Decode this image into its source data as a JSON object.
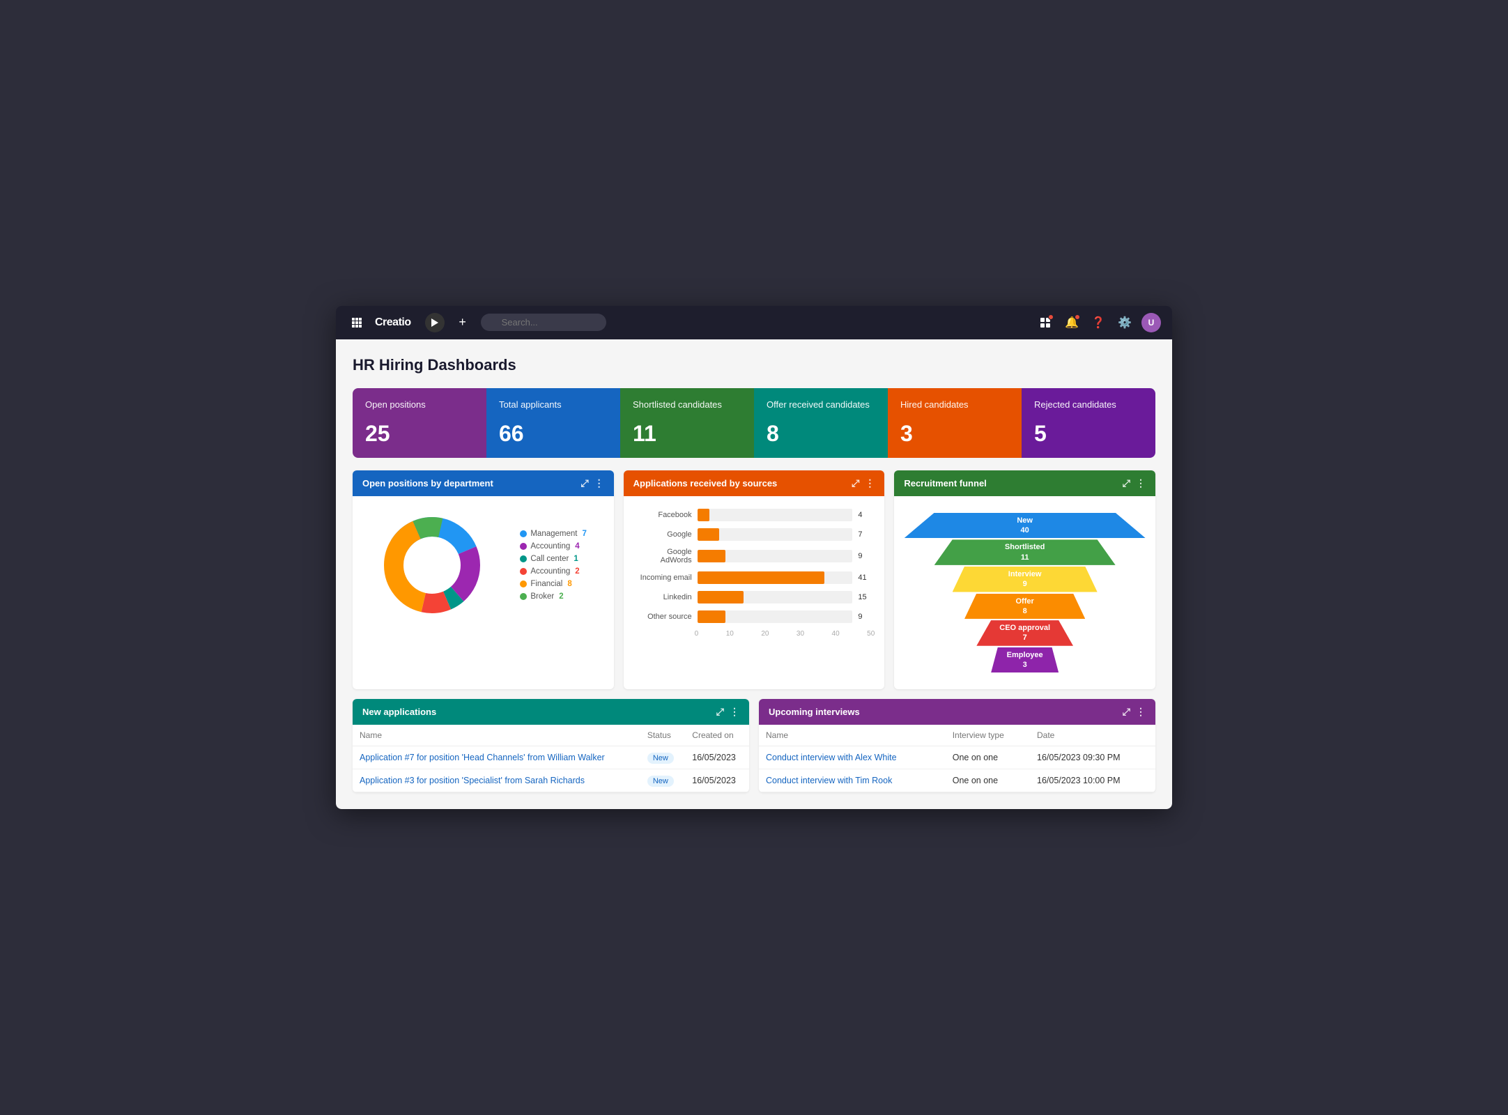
{
  "app": {
    "title": "Creatio",
    "search_placeholder": "Search..."
  },
  "page": {
    "title": "HR Hiring Dashboards"
  },
  "stat_cards": [
    {
      "label": "Open positions",
      "value": "25",
      "color": "stat-purple"
    },
    {
      "label": "Total applicants",
      "value": "66",
      "color": "stat-blue"
    },
    {
      "label": "Shortlisted candidates",
      "value": "11",
      "color": "stat-green"
    },
    {
      "label": "Offer received candidates",
      "value": "8",
      "color": "stat-teal"
    },
    {
      "label": "Hired candidates",
      "value": "3",
      "color": "stat-orange"
    },
    {
      "label": "Rejected candidates",
      "value": "5",
      "color": "stat-violet"
    }
  ],
  "open_positions_widget": {
    "title": "Open positions by department",
    "segments": [
      {
        "label": "Management",
        "value": 7,
        "color": "#2196f3",
        "pct": 35
      },
      {
        "label": "Accounting",
        "value": 4,
        "color": "#9c27b0",
        "pct": 20
      },
      {
        "label": "Call center",
        "value": 1,
        "color": "#009688",
        "pct": 5
      },
      {
        "label": "Accounting 2",
        "value": 2,
        "color": "#f44336",
        "pct": 10
      },
      {
        "label": "Financial",
        "value": 8,
        "color": "#ff9800",
        "pct": 40
      },
      {
        "label": "Broker",
        "value": 2,
        "color": "#4caf50",
        "pct": 10
      }
    ]
  },
  "sources_widget": {
    "title": "Applications received by sources",
    "bars": [
      {
        "label": "Facebook",
        "value": 4,
        "max": 50
      },
      {
        "label": "Google",
        "value": 7,
        "max": 50
      },
      {
        "label": "Google AdWords",
        "value": 9,
        "max": 50
      },
      {
        "label": "Incoming email",
        "value": 41,
        "max": 50
      },
      {
        "label": "Linkedin",
        "value": 15,
        "max": 50
      },
      {
        "label": "Other source",
        "value": 9,
        "max": 50
      }
    ],
    "axis_labels": [
      "0",
      "10",
      "20",
      "30",
      "40",
      "50"
    ]
  },
  "funnel_widget": {
    "title": "Recruitment funnel",
    "levels": [
      {
        "label": "New",
        "value": 40,
        "color": "#1e88e5",
        "width_pct": 100
      },
      {
        "label": "Shortlisted",
        "value": 11,
        "color": "#43a047",
        "width_pct": 75
      },
      {
        "label": "Interview",
        "value": 9,
        "color": "#fdd835",
        "width_pct": 60
      },
      {
        "label": "Offer",
        "value": 8,
        "color": "#fb8c00",
        "width_pct": 50
      },
      {
        "label": "CEO approval",
        "value": 7,
        "color": "#e53935",
        "width_pct": 40
      },
      {
        "label": "Employee",
        "value": 3,
        "color": "#8e24aa",
        "width_pct": 28
      }
    ]
  },
  "new_applications_widget": {
    "title": "New applications",
    "columns": [
      "Name",
      "Status",
      "Created on"
    ],
    "rows": [
      {
        "name": "Application #7 for position 'Head Channels' from William Walker",
        "status": "New",
        "created_on": "16/05/2023"
      },
      {
        "name": "Application #3 for position 'Specialist' from Sarah Richards",
        "status": "New",
        "created_on": "16/05/2023"
      }
    ]
  },
  "upcoming_interviews_widget": {
    "title": "Upcoming interviews",
    "columns": [
      "Name",
      "Interview type",
      "Date"
    ],
    "rows": [
      {
        "name": "Conduct interview with Alex White",
        "type": "One on one",
        "date": "16/05/2023 09:30 PM"
      },
      {
        "name": "Conduct interview with Tim Rook",
        "type": "One on one",
        "date": "16/05/2023 10:00 PM"
      }
    ]
  }
}
